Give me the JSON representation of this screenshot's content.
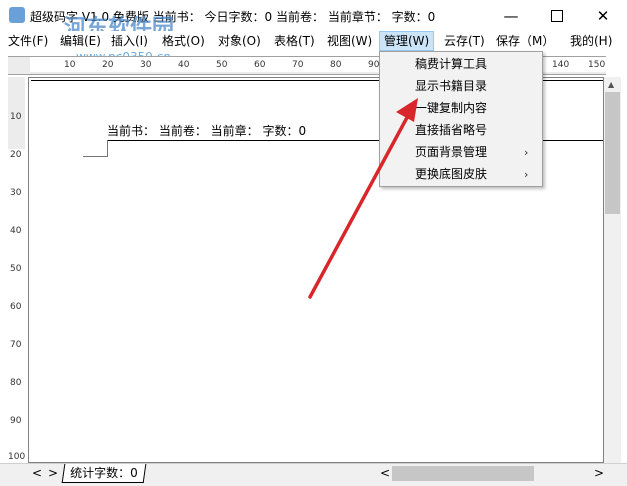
{
  "titlebar": {
    "title": "超级码字 V1.0 免费版  当前书：  今日字数：0  当前卷：    当前章节：  字数：0",
    "minimize_icon": "minimize-icon",
    "maximize_icon": "maximize-icon",
    "close_icon": "close-icon"
  },
  "watermark": {
    "name": "河东软件园",
    "url": "www.pc0359.cn"
  },
  "menubar": {
    "items": [
      "文件(F)",
      "编辑(E)",
      "插入(I)",
      "格式(O)",
      "对象(O)",
      "表格(T)",
      "视图(W)",
      "管理(W)",
      "云存(T)",
      "保存（M）",
      "我的(H)"
    ]
  },
  "dropdown": {
    "items": [
      {
        "label": "稿费计算工具",
        "submenu": false
      },
      {
        "label": "显示书籍目录",
        "submenu": false
      },
      {
        "label": "一键复制内容",
        "submenu": false
      },
      {
        "label": "直接插省略号",
        "submenu": false
      },
      {
        "label": "页面背景管理",
        "submenu": true
      },
      {
        "label": "更换底图皮肤",
        "submenu": true
      }
    ],
    "submenu_glyph": "›"
  },
  "ruler": {
    "h_labels": [
      "10",
      "20",
      "30",
      "40",
      "50",
      "60",
      "70",
      "80",
      "90",
      "140",
      "150"
    ],
    "v_labels": [
      "10",
      "20",
      "30",
      "40",
      "50",
      "60",
      "70",
      "80",
      "90",
      "100"
    ]
  },
  "editor": {
    "header_text": "当前书：  当前卷：  当前章：  字数：0"
  },
  "statusbar": {
    "tab_label": "统计字数：0",
    "left_arrow": "<",
    "right_arrow": ">"
  },
  "colors": {
    "annotation_arrow": "#d9262b",
    "menu_highlight": "#cce4f7"
  }
}
